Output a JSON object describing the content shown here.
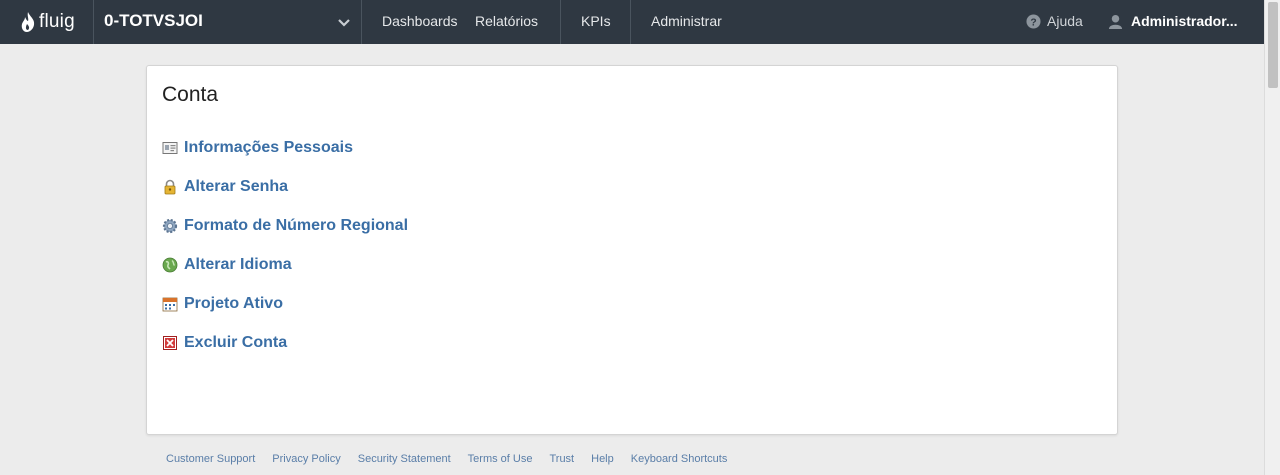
{
  "navbar": {
    "logo_text": "fluig",
    "context_name": "0-TOTVSJOI",
    "links": [
      "Dashboards",
      "Relatórios",
      "KPIs",
      "Administrar"
    ],
    "help_label": "Ajuda",
    "user_label": "Administrador..."
  },
  "panel": {
    "title": "Conta",
    "items": [
      {
        "label": "Informações Pessoais",
        "icon": "id-card-icon"
      },
      {
        "label": "Alterar Senha",
        "icon": "lock-icon"
      },
      {
        "label": "Formato de Número Regional",
        "icon": "gear-icon"
      },
      {
        "label": "Alterar Idioma",
        "icon": "globe-icon"
      },
      {
        "label": "Projeto Ativo",
        "icon": "calendar-icon"
      },
      {
        "label": "Excluir Conta",
        "icon": "delete-icon"
      }
    ]
  },
  "footer": {
    "links": [
      "Customer Support",
      "Privacy Policy",
      "Security Statement",
      "Terms of Use",
      "Trust",
      "Help",
      "Keyboard Shortcuts"
    ]
  },
  "colors": {
    "navbar_bg": "#2f3842",
    "link": "#3a6ea5",
    "page_bg": "#ececec"
  }
}
